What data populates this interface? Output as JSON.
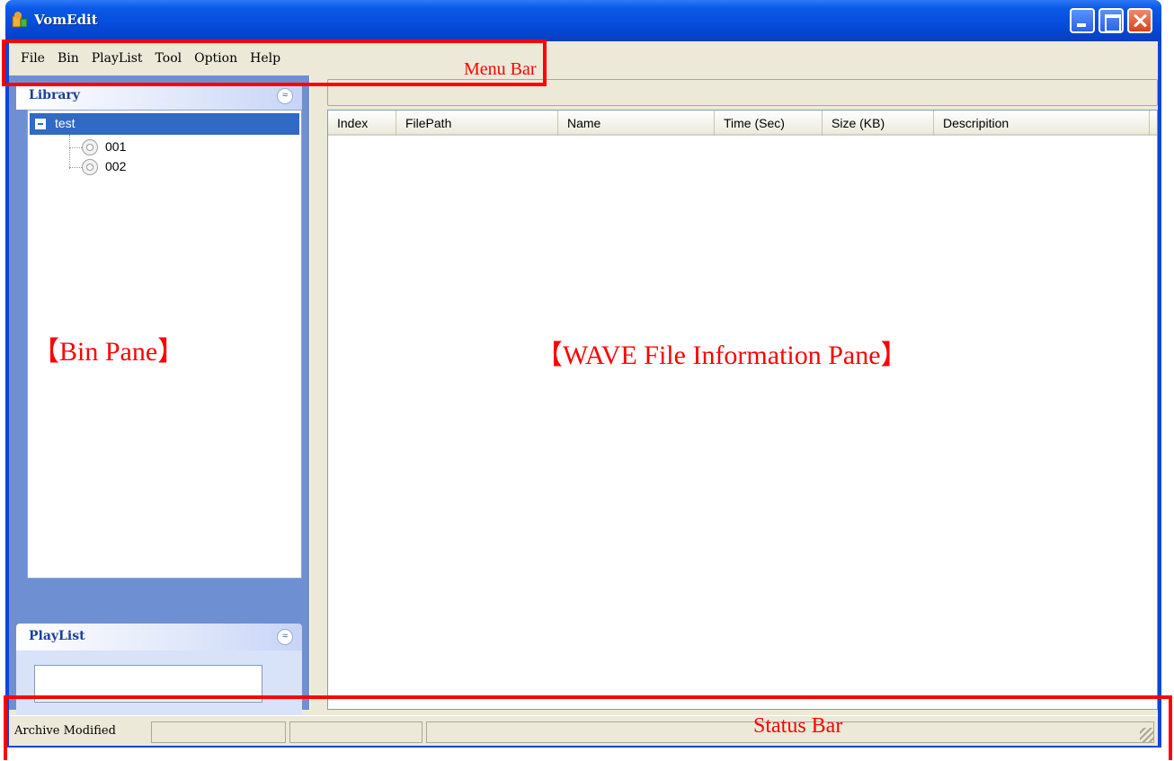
{
  "window": {
    "title": "VomEdit"
  },
  "menu": {
    "items": [
      "File",
      "Bin",
      "PlayList",
      "Tool",
      "Option",
      "Help"
    ]
  },
  "library": {
    "title": "Library",
    "collapse_glyph": "≈",
    "tree": {
      "root": "test",
      "children": [
        "001",
        "002"
      ]
    }
  },
  "playlist": {
    "title": "PlayList",
    "collapse_glyph": "≈",
    "input_value": ""
  },
  "list": {
    "columns": [
      "Index",
      "FilePath",
      "Name",
      "Time (Sec)",
      "Size (KB)",
      "Descripition"
    ]
  },
  "status": {
    "cells": [
      "Archive Modified",
      "",
      "",
      ""
    ]
  },
  "annotations": {
    "menu_bar": "Menu Bar",
    "status_bar": "Status Bar",
    "bin_pane": "【Bin Pane】",
    "wave_pane": "【WAVE File Information Pane】"
  },
  "colors": {
    "titlebar": "#0548d6",
    "selection": "#316ac5",
    "annotation": "#ff0000",
    "pane_bg": "#6f8fd3"
  }
}
